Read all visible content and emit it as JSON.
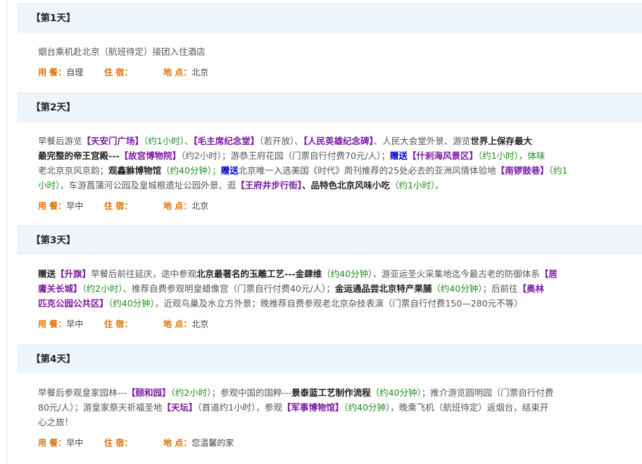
{
  "days": [
    {
      "title": "【第1天】",
      "desc": [
        [
          {
            "t": "烟台乘机赴北京（航班待定）接团入住酒店",
            "c": ""
          }
        ]
      ],
      "meals_label": "用 餐：",
      "meals": "自理",
      "stay_label": "住 宿：",
      "stay": "",
      "place_label": "地 点：",
      "place": "北京"
    },
    {
      "title": "【第2天】",
      "desc": [
        [
          {
            "t": "早餐后游览",
            "c": ""
          },
          {
            "t": "【天安门广场】",
            "c": "hl"
          },
          {
            "t": "（约1小时）、",
            "c": "gr"
          },
          {
            "t": "【毛主席纪念堂】",
            "c": "hl"
          },
          {
            "t": "（若开放）、",
            "c": ""
          },
          {
            "t": "【人民英雄纪念碑】",
            "c": "hl"
          },
          {
            "t": "、人民大会堂外景、游览",
            "c": ""
          },
          {
            "t": "世界上保存最大",
            "c": "dk"
          }
        ],
        [
          {
            "t": "最完整的帝王宫殿---",
            "c": "dk"
          },
          {
            "t": "【故宫博物院】",
            "c": "hl"
          },
          {
            "t": "（约2小时）；游恭王府花园（门票自行付费70元/人）；",
            "c": ""
          },
          {
            "t": "赠送",
            "c": "bl"
          },
          {
            "t": "【什刹海风景区】",
            "c": "hl"
          },
          {
            "t": "（约1小时），体味",
            "c": "gr"
          }
        ],
        [
          {
            "t": "老北京京风京韵；",
            "c": ""
          },
          {
            "t": "观鑫貅博物馆",
            "c": "dk"
          },
          {
            "t": "（约40分钟）；",
            "c": "gr"
          },
          {
            "t": "赠送",
            "c": "bl"
          },
          {
            "t": "北京唯一入选美国《时代》周刊推荐的25处必去的亚洲风情体验地",
            "c": ""
          },
          {
            "t": "【南锣鼓巷】",
            "c": "hl"
          },
          {
            "t": "（约1",
            "c": "gr"
          }
        ],
        [
          {
            "t": "小时）",
            "c": "gr"
          },
          {
            "t": "，车游菖蒲河公园及皇城根遗址公园外景、逛",
            "c": ""
          },
          {
            "t": "【王府井步行街】",
            "c": "hl"
          },
          {
            "t": "、品特色北京风味小吃",
            "c": "dk"
          },
          {
            "t": "（约1小时）。",
            "c": "gr"
          }
        ]
      ],
      "meals_label": "用 餐：",
      "meals": "早中",
      "stay_label": "住 宿：",
      "stay": "",
      "place_label": "地 点：",
      "place": "北京"
    },
    {
      "title": "【第3天】",
      "desc": [
        [
          {
            "t": "赠送",
            "c": "dk"
          },
          {
            "t": "【升旗】",
            "c": "hl"
          },
          {
            "t": "早餐后前往延庆，途中参观",
            "c": ""
          },
          {
            "t": "北京最著名的玉雕工艺---金肆维",
            "c": "dk"
          },
          {
            "t": "（约40分钟）",
            "c": "gr"
          },
          {
            "t": "，游亚运圣火采集地迄今最古老的防御体系",
            "c": ""
          },
          {
            "t": "【居",
            "c": "hl"
          }
        ],
        [
          {
            "t": "庸关长城】",
            "c": "hl"
          },
          {
            "t": "（约2小时）",
            "c": "gr"
          },
          {
            "t": "、推荐自费参观明皇蜡像宫（门票自行付费40元/人）；",
            "c": ""
          },
          {
            "t": "金运通品尝北京特产果脯",
            "c": "dk"
          },
          {
            "t": "（约40分钟）",
            "c": "gr"
          },
          {
            "t": "；后前往",
            "c": ""
          },
          {
            "t": "【奥林",
            "c": "hl"
          }
        ],
        [
          {
            "t": "匹克公园公共区】",
            "c": "hl"
          },
          {
            "t": "（约40分钟）",
            "c": "gr"
          },
          {
            "t": "，近观鸟巢及水立方外景；晚推荐自费参观老北京杂技表演（门票自行付费150—280元不等）",
            "c": ""
          }
        ]
      ],
      "meals_label": "用 餐：",
      "meals": "早中",
      "stay_label": "住 宿：",
      "stay": "",
      "place_label": "地 点：",
      "place": "北京"
    },
    {
      "title": "【第4天】",
      "desc": [
        [
          {
            "t": "早餐后参观皇家园林---",
            "c": ""
          },
          {
            "t": "【颐和园】",
            "c": "hl"
          },
          {
            "t": "（约2小时）",
            "c": "gr"
          },
          {
            "t": "；参观中国的国粹---",
            "c": ""
          },
          {
            "t": "景泰蓝工艺制作流程",
            "c": "dk"
          },
          {
            "t": "（约40分钟）",
            "c": "gr"
          },
          {
            "t": "；推介游览圆明园（门票自行付费",
            "c": ""
          }
        ],
        [
          {
            "t": "80元/人）；游皇家祭天祈福圣地",
            "c": ""
          },
          {
            "t": "【天坛】",
            "c": "hl"
          },
          {
            "t": "（首道约1小时），参观",
            "c": ""
          },
          {
            "t": "【军事博物馆】",
            "c": "hl"
          },
          {
            "t": "（约40分钟）",
            "c": "gr"
          },
          {
            "t": "，晚乘飞机（航班待定）返烟台，结束开",
            "c": ""
          }
        ],
        [
          {
            "t": "心之旅！",
            "c": ""
          }
        ]
      ],
      "meals_label": "用 餐：",
      "meals": "早中",
      "stay_label": "住 宿：",
      "stay": "",
      "place_label": "地 点：",
      "place": "您温馨的家"
    }
  ]
}
